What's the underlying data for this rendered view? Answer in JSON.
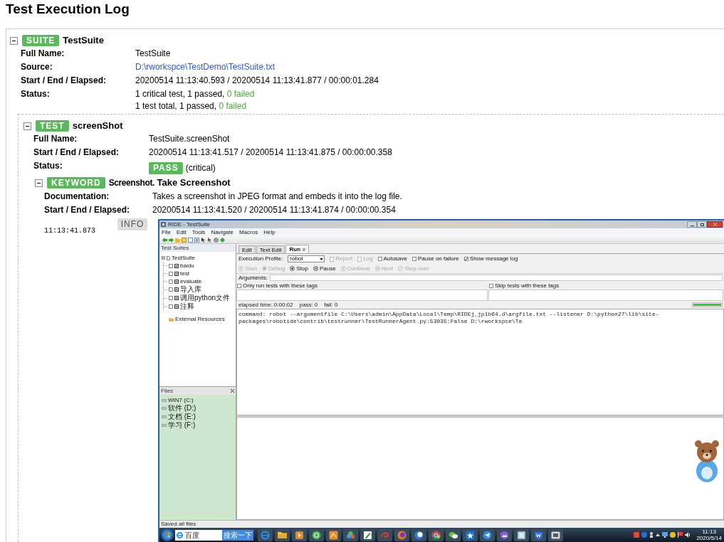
{
  "page_title": "Test Execution Log",
  "suite": {
    "badge": "SUITE",
    "name": "TestSuite",
    "expanded": true,
    "fields": [
      {
        "kind": "text",
        "label": "Full Name:",
        "value": "TestSuite"
      },
      {
        "kind": "link",
        "label": "Source:",
        "value": "D:\\rworkspce\\TestDemo\\TestSuite.txt"
      },
      {
        "kind": "text",
        "label": "Start / End / Elapsed:",
        "value": "20200514 11:13:40.593 / 20200514 11:13:41.877 / 00:00:01.284"
      },
      {
        "kind": "stats",
        "label": "Status:",
        "lines": [
          {
            "text": "1 critical test, 1 passed,",
            "failed": "0 failed"
          },
          {
            "text": "1 test total, 1 passed,",
            "failed": "0 failed"
          }
        ]
      }
    ],
    "test": {
      "badge": "TEST",
      "name": "screenShot",
      "expanded": true,
      "fields": [
        {
          "kind": "text",
          "label": "Full Name:",
          "value": "TestSuite.screenShot"
        },
        {
          "kind": "text",
          "label": "Start / End / Elapsed:",
          "value": "20200514 11:13:41.517 / 20200514 11:13:41.875 / 00:00:00.358"
        },
        {
          "kind": "status",
          "label": "Status:",
          "status": "PASS",
          "note": "(critical)"
        }
      ],
      "keyword": {
        "badge": "KEYWORD",
        "library": "Screenshot.",
        "name": "Take Screenshot",
        "expanded": true,
        "fields": [
          {
            "kind": "text",
            "label": "Documentation:",
            "value": "Takes a screenshot in JPEG format and embeds it into the log file."
          },
          {
            "kind": "text",
            "label": "Start / End / Elapsed:",
            "value": "20200514 11:13:41.520 / 20200514 11:13:41.874 / 00:00:00.354"
          }
        ],
        "message": {
          "time": "11:13:41.873",
          "level": "INFO",
          "screenshot": {
            "window_title": "RIDE - TestSuite",
            "menu": [
              "File",
              "Edit",
              "Tools",
              "Navigate",
              "Macros",
              "Help"
            ],
            "tree_title": "Test Suites",
            "tree": [
              {
                "label": "TestSuite",
                "expanded": true,
                "children": [
                  {
                    "label": "baidu",
                    "checked": false
                  },
                  {
                    "label": "test",
                    "checked": false
                  },
                  {
                    "label": "evaluate",
                    "checked": false
                  },
                  {
                    "label": "导入库",
                    "checked": false
                  },
                  {
                    "label": "调用python文件",
                    "checked": false
                  },
                  {
                    "label": "注释",
                    "checked": false
                  }
                ]
              }
            ],
            "resources": "External Resources",
            "files_title": "Files",
            "drives": [
              "WIN7 (C:)",
              "软件 (D:)",
              "文档 (E:)",
              "学习 (F:)"
            ],
            "tabs": [
              {
                "label": "Edit",
                "selected": false
              },
              {
                "label": "Text Edit",
                "selected": false
              },
              {
                "label": "Run",
                "selected": true
              }
            ],
            "profile_label": "Execution Profile:",
            "profile": "robot",
            "options": [
              {
                "kind": "button",
                "label": "Report",
                "disabled": true
              },
              {
                "kind": "button",
                "label": "Log",
                "disabled": true
              },
              {
                "kind": "checkbox",
                "label": "Autosave",
                "checked": false
              },
              {
                "kind": "checkbox",
                "label": "Pause on failure",
                "checked": false
              },
              {
                "kind": "checkbox",
                "label": "Show message log",
                "checked": true
              }
            ],
            "run_buttons": [
              {
                "kind": "start",
                "label": "Start",
                "disabled": true
              },
              {
                "kind": "debug",
                "label": "Debug",
                "disabled": true
              },
              {
                "kind": "stop",
                "label": "Stop",
                "disabled": false
              },
              {
                "kind": "pause",
                "label": "Pause",
                "disabled": false
              },
              {
                "kind": "continue",
                "label": "Continue",
                "disabled": true
              },
              {
                "kind": "next",
                "label": "Next",
                "disabled": true
              },
              {
                "kind": "step",
                "label": "Step over",
                "disabled": true
              }
            ],
            "arguments_label": "Arguments:",
            "tag_filters": [
              {
                "label": "Only run tests with these tags",
                "checked": false
              },
              {
                "label": "Skip tests with these tags",
                "checked": false
              }
            ],
            "run_stats": [
              "elapsed time: 0:00:02",
              "pass: 0",
              "fail: 0"
            ],
            "progress": {
              "level": 1
            },
            "command": "command: robot --argumentfile C:\\Users\\admin\\AppData\\Local\\Temp\\RIDEj_jp1b64.d\\argfile.txt --listener D:\\python27\\lib\\site-packages\\robotide\\contrib\\testrunner\\TestRunnerAgent.py:53035:False D:\\rworkspce\\Te",
            "status_bar": "Saved all files",
            "taskbar": {
              "search_text": "百度",
              "search_button": "搜索一下",
              "clock_time": "11:13",
              "clock_date": "2020/5/14"
            }
          }
        }
      }
    }
  }
}
